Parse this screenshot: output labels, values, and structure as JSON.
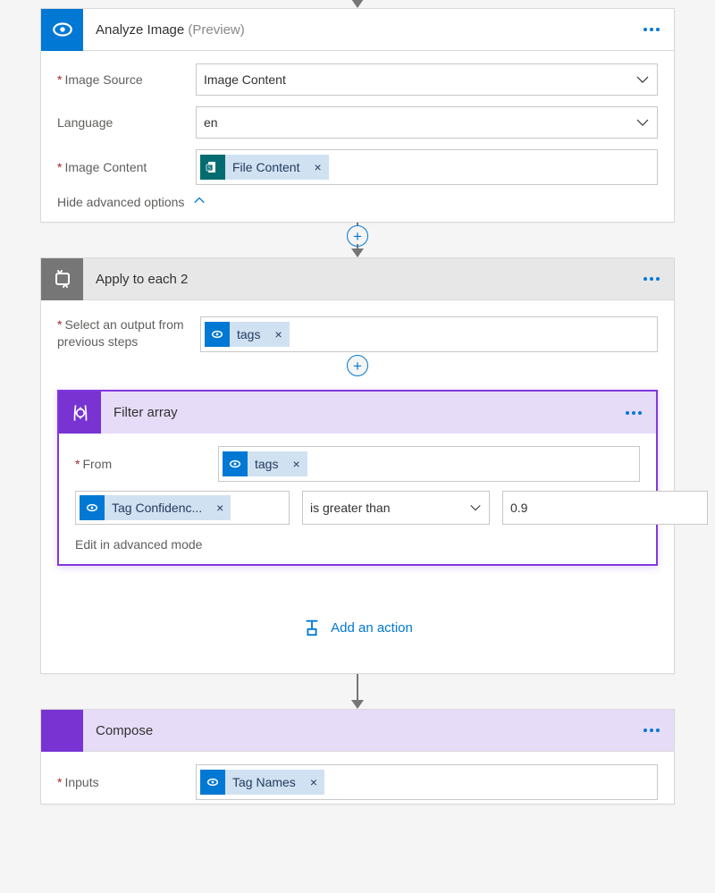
{
  "analyze": {
    "title": "Analyze Image",
    "preview": "(Preview)",
    "fields": {
      "imageSourceLabel": "Image Source",
      "imageSourceValue": "Image Content",
      "languageLabel": "Language",
      "languageValue": "en",
      "imageContentLabel": "Image Content",
      "fileContentToken": "File Content"
    },
    "advancedToggle": "Hide advanced options"
  },
  "loop": {
    "title": "Apply to each 2",
    "selectLabel": "Select an output from previous steps",
    "tagsToken": "tags"
  },
  "filter": {
    "title": "Filter array",
    "fromLabel": "From",
    "fromToken": "tags",
    "valueToken": "Tag Confidenc...",
    "operator": "is greater than",
    "compareValue": "0.9",
    "editLink": "Edit in advanced mode"
  },
  "addAction": "Add an action",
  "compose": {
    "title": "Compose",
    "inputsLabel": "Inputs",
    "inputsToken": "Tag Names"
  }
}
